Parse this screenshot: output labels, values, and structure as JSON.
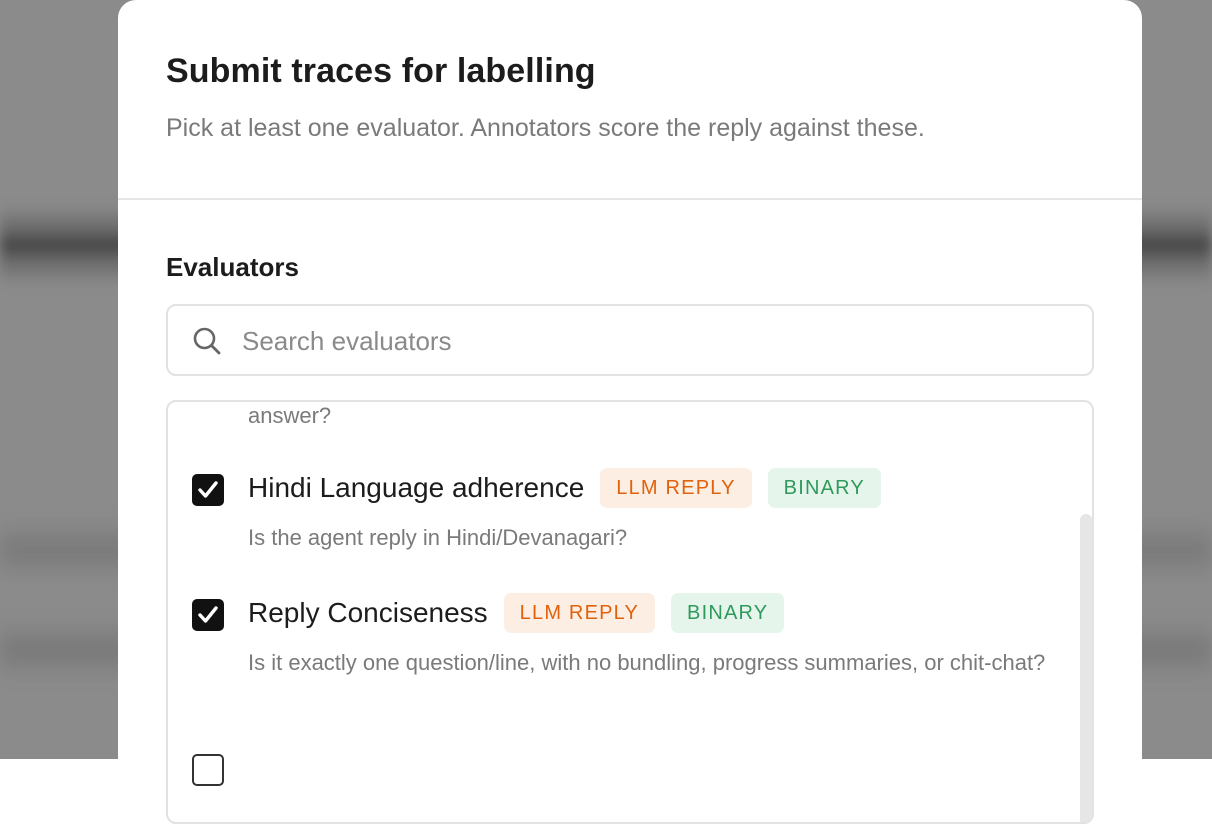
{
  "modal": {
    "title": "Submit traces for labelling",
    "subtitle": "Pick at least one evaluator. Annotators score the reply against these."
  },
  "evaluators_section": {
    "label": "Evaluators",
    "search": {
      "placeholder": "Search evaluators",
      "value": ""
    }
  },
  "evaluators": {
    "cropped_previous_description": "answer?",
    "items": [
      {
        "name": "Hindi Language adherence",
        "checked": true,
        "badges": [
          "LLM REPLY",
          "BINARY"
        ],
        "description": "Is the agent reply in Hindi/Devanagari?"
      },
      {
        "name": "Reply Conciseness",
        "checked": true,
        "badges": [
          "LLM REPLY",
          "BINARY"
        ],
        "description": "Is it exactly one question/line, with no bundling, progress summaries, or chit-chat?"
      },
      {
        "name": "",
        "checked": false,
        "badges": [],
        "description": ""
      }
    ]
  },
  "colors": {
    "llm_badge_bg": "#fdeee3",
    "llm_badge_text": "#e0620c",
    "binary_badge_bg": "#e6f5ec",
    "binary_badge_text": "#2e9a5c",
    "checkbox_checked": "#111111"
  }
}
